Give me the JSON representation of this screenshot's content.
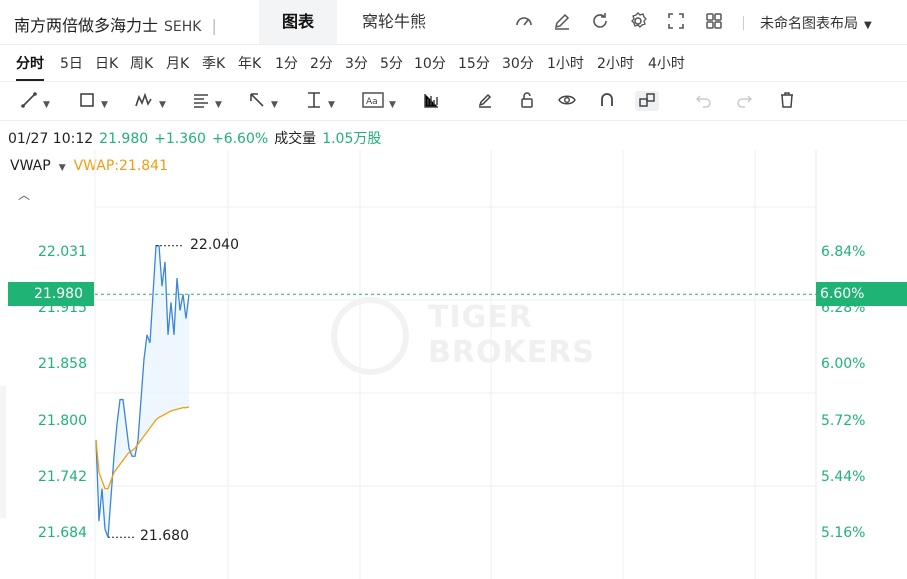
{
  "header": {
    "title": "南方两倍做多海力士",
    "exchange": "SEHK",
    "separator": "|",
    "tabs": [
      {
        "label": "图表",
        "active": true
      },
      {
        "label": "窝轮牛熊",
        "active": false
      }
    ],
    "layout_name": "未命名图表布局",
    "icons": [
      "speedometer-icon",
      "pencil-icon",
      "refresh-icon",
      "gear-icon",
      "fullscreen-icon",
      "grid-layout-icon"
    ]
  },
  "periods": [
    "分时",
    "5日",
    "日K",
    "周K",
    "月K",
    "季K",
    "年K",
    "1分",
    "2分",
    "3分",
    "5分",
    "10分",
    "15分",
    "30分",
    "1小时",
    "2小时",
    "4小时"
  ],
  "active_period": "分时",
  "drawing_tools": [
    "trend-line-icon",
    "rectangle-icon",
    "pattern-icon",
    "fib-icon",
    "arrow-icon",
    "ruler-icon",
    "text-icon",
    "bar-indicator-icon",
    "brush-icon",
    "lock-icon",
    "eye-icon",
    "magnet-icon",
    "link-icon",
    "undo-icon",
    "redo-icon",
    "trash-icon"
  ],
  "quote": {
    "time": "01/27 10:12",
    "price": "21.980",
    "change": "+1.360",
    "change_pct": "+6.60%",
    "volume_label": "成交量",
    "volume": "1.05万股"
  },
  "indicator": {
    "name": "VWAP",
    "value_label": "VWAP:21.841"
  },
  "colors": {
    "up": "#1fb375",
    "vwap": "#f39c12",
    "price_line": "#3a86d8"
  },
  "chart_data": {
    "type": "line",
    "y_ticks_left": [
      "22.031",
      "21.915",
      "21.858",
      "21.800",
      "21.742",
      "21.684"
    ],
    "current_price_label": "21.980",
    "y_ticks_right": [
      "6.84%",
      "6.28%",
      "6.00%",
      "5.72%",
      "5.44%",
      "5.16%"
    ],
    "current_pct_label": "6.60%",
    "high_marker": "22.040",
    "low_marker": "21.680",
    "ylim": [
      21.66,
      22.06
    ],
    "series": [
      {
        "values": [
          21.8,
          21.7,
          21.74,
          21.69,
          21.68,
          21.73,
          21.78,
          21.82,
          21.85,
          21.85,
          21.82,
          21.79,
          21.78,
          21.78,
          21.8,
          21.85,
          21.9,
          21.93,
          21.92,
          21.98,
          22.04,
          22.04,
          21.99,
          22.02,
          21.93,
          21.97,
          21.93,
          22.0,
          21.96,
          21.98,
          21.95,
          21.98
        ]
      },
      {
        "values": [
          21.8,
          21.76,
          21.75,
          21.74,
          21.74,
          21.75,
          21.76,
          21.765,
          21.77,
          21.775,
          21.78,
          21.785,
          21.787,
          21.79,
          21.795,
          21.8,
          21.805,
          21.81,
          21.815,
          21.82,
          21.825,
          21.828,
          21.83,
          21.832,
          21.834,
          21.836,
          21.837,
          21.838,
          21.839,
          21.84,
          21.84,
          21.841
        ]
      }
    ],
    "watermark": [
      "TIGER",
      "BROKERS"
    ]
  }
}
